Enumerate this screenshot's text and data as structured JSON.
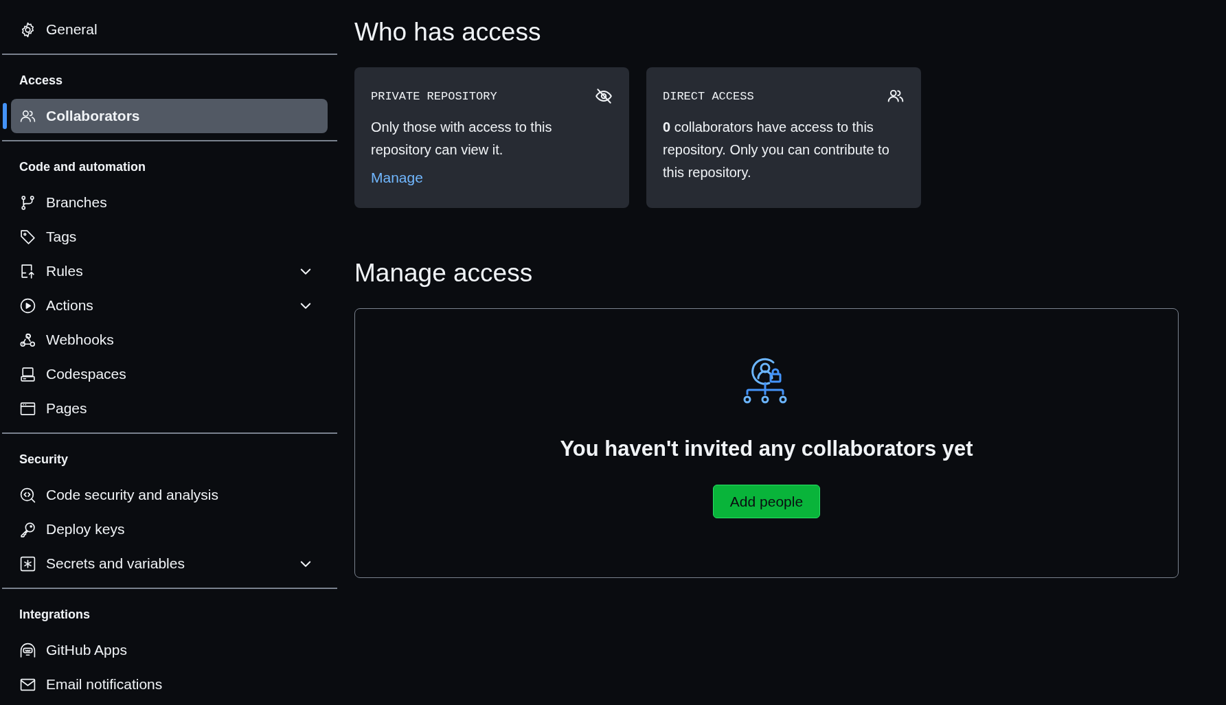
{
  "sidebar": {
    "sections": [
      {
        "items": [
          {
            "label": "General",
            "selected": false,
            "has_submenu": false
          }
        ]
      },
      {
        "heading": "Access",
        "items": [
          {
            "label": "Collaborators",
            "selected": true,
            "has_submenu": false
          }
        ]
      },
      {
        "heading": "Code and automation",
        "items": [
          {
            "label": "Branches",
            "selected": false,
            "has_submenu": false
          },
          {
            "label": "Tags",
            "selected": false,
            "has_submenu": false
          },
          {
            "label": "Rules",
            "selected": false,
            "has_submenu": true
          },
          {
            "label": "Actions",
            "selected": false,
            "has_submenu": true
          },
          {
            "label": "Webhooks",
            "selected": false,
            "has_submenu": false
          },
          {
            "label": "Codespaces",
            "selected": false,
            "has_submenu": false
          },
          {
            "label": "Pages",
            "selected": false,
            "has_submenu": false
          }
        ]
      },
      {
        "heading": "Security",
        "items": [
          {
            "label": "Code security and analysis",
            "selected": false,
            "has_submenu": false
          },
          {
            "label": "Deploy keys",
            "selected": false,
            "has_submenu": false
          },
          {
            "label": "Secrets and variables",
            "selected": false,
            "has_submenu": true
          }
        ]
      },
      {
        "heading": "Integrations",
        "items": [
          {
            "label": "GitHub Apps",
            "selected": false,
            "has_submenu": false
          },
          {
            "label": "Email notifications",
            "selected": false,
            "has_submenu": false
          }
        ]
      }
    ]
  },
  "who_has_access": {
    "title": "Who has access",
    "cards": [
      {
        "label": "PRIVATE REPOSITORY",
        "text": "Only those with access to this repository can view it.",
        "link": "Manage"
      },
      {
        "label": "DIRECT ACCESS",
        "text": "**0** collaborators have access to this repository. Only you can contribute to this repository."
      }
    ]
  },
  "manage_access": {
    "title": "Manage access",
    "empty_message": "You haven't invited any collaborators yet",
    "button": "Add people"
  }
}
